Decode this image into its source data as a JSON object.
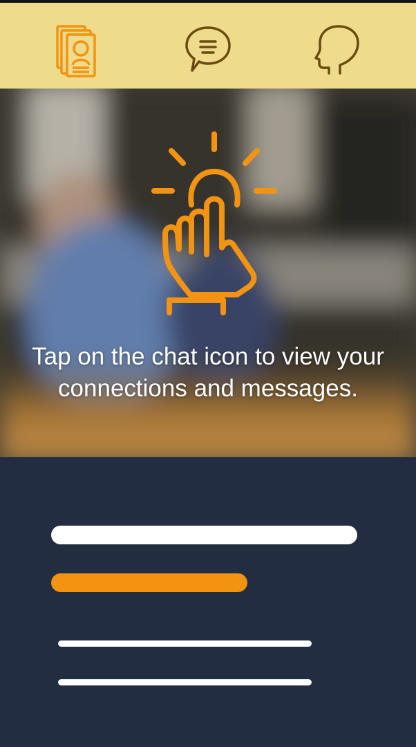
{
  "colors": {
    "tabbar_bg": "#eedb8c",
    "accent": "#f39312",
    "icon_dark": "#6b4a12",
    "bottom_bg": "#232d42",
    "placeholder_light": "#ffffff"
  },
  "tabs": [
    {
      "icon": "profile-cards-icon",
      "active": true
    },
    {
      "icon": "chat-bubble-icon",
      "active": false
    },
    {
      "icon": "head-profile-icon",
      "active": false
    }
  ],
  "hero": {
    "icon": "tap-finger-icon",
    "hint_text": "Tap on the chat icon to view your connections and messages."
  },
  "placeholders": [
    "white-bar",
    "orange-bar",
    "thin-white-line",
    "thin-white-line"
  ]
}
